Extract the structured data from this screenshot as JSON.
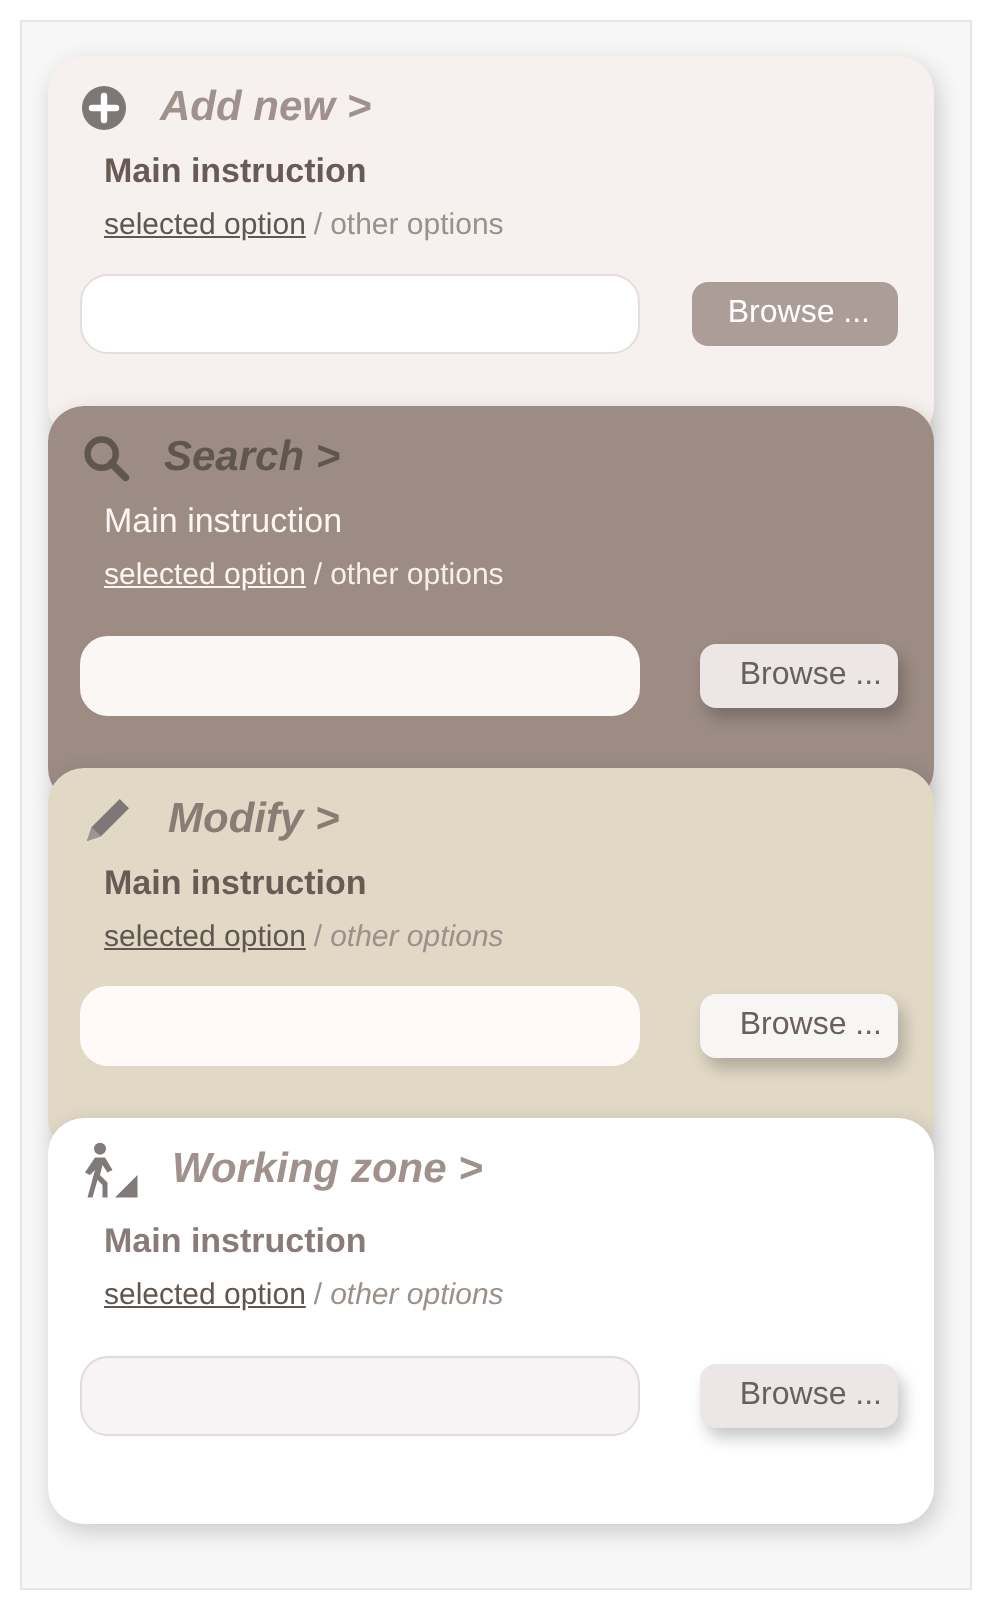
{
  "cards": [
    {
      "kind": "add",
      "color": "#f6f1ef",
      "title": "Add new >",
      "instruction": "Main instruction",
      "selected_option": "selected option",
      "separator": "/",
      "other_options": "other options",
      "button": "Browse ..."
    },
    {
      "kind": "search",
      "color": "#9c8c83",
      "title": "Search >",
      "instruction": "Main instruction",
      "selected_option": "selected option",
      "separator": "/",
      "other_options": "other options",
      "button": "Browse ..."
    },
    {
      "kind": "modify",
      "color": "#e1d8c6",
      "title": "Modify >",
      "instruction": "Main instruction",
      "selected_option": "selected option",
      "separator": "/",
      "other_options": "other options",
      "button": "Browse ..."
    },
    {
      "kind": "working",
      "color": "#ffffff",
      "title": "Working zone >",
      "instruction": "Main instruction",
      "selected_option": "selected option",
      "separator": "/",
      "other_options": "other options",
      "button": "Browse ..."
    }
  ]
}
